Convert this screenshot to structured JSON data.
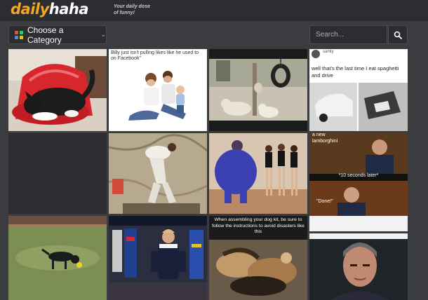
{
  "header": {
    "logo_part1": "daily",
    "logo_part2": "haha",
    "tagline": "Your daily dose of funny!"
  },
  "category_button": {
    "label": "Choose a Category"
  },
  "search": {
    "placeholder": "Search..."
  },
  "tiles": {
    "t2_caption": "Billy just isn't pulling likes like he used to on Facebook\"",
    "t4_handle": "sanity",
    "t4_text": "well that's the last time I eat spaghetti and drive",
    "t8_top": "a new lamborghini",
    "t8_mid": "*10 seconds later*",
    "t8_bottom": "\"Done!\"",
    "t10_caption": "When assembling your dog kit, be sure to follow the instructions to avoid disasters like this"
  },
  "colors": {
    "accent": "#f5a623",
    "header_bg": "#2b2d31",
    "page_bg": "#3a3c40"
  }
}
